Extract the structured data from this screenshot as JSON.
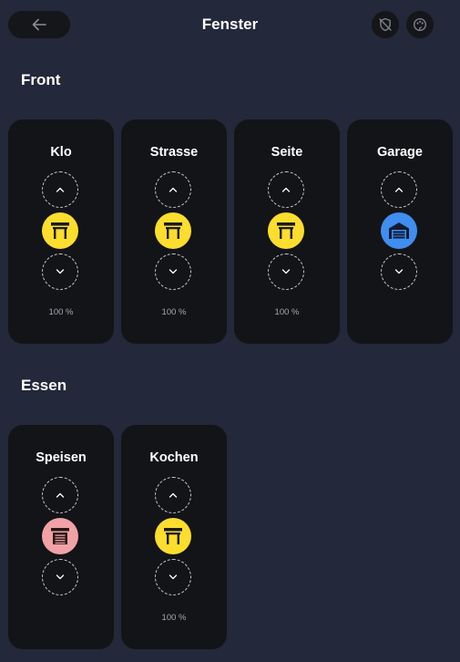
{
  "header": {
    "title": "Fenster",
    "back_icon": "arrow-left-icon",
    "shield_icon": "shield-off-icon",
    "theme_icon": "palette-icon"
  },
  "colors": {
    "background": "#23283a",
    "card": "#131417",
    "open_yellow": "#fddd2d",
    "garage_blue": "#3f8ef0",
    "closed_pink": "#f0a2a6"
  },
  "sections": [
    {
      "title": "Front",
      "cards": [
        {
          "name": "Klo",
          "percent": "100 %",
          "state": "open",
          "icon": "window-shutter-open-icon"
        },
        {
          "name": "Strasse",
          "percent": "100 %",
          "state": "open",
          "icon": "window-shutter-open-icon"
        },
        {
          "name": "Seite",
          "percent": "100 %",
          "state": "open",
          "icon": "window-shutter-open-icon"
        },
        {
          "name": "Garage",
          "percent": "",
          "state": "garage",
          "icon": "garage-icon"
        }
      ]
    },
    {
      "title": "Essen",
      "cards": [
        {
          "name": "Speisen",
          "percent": "",
          "state": "closed",
          "icon": "window-shutter-closed-icon"
        },
        {
          "name": "Kochen",
          "percent": "100 %",
          "state": "open",
          "icon": "window-shutter-open-icon"
        }
      ]
    }
  ]
}
